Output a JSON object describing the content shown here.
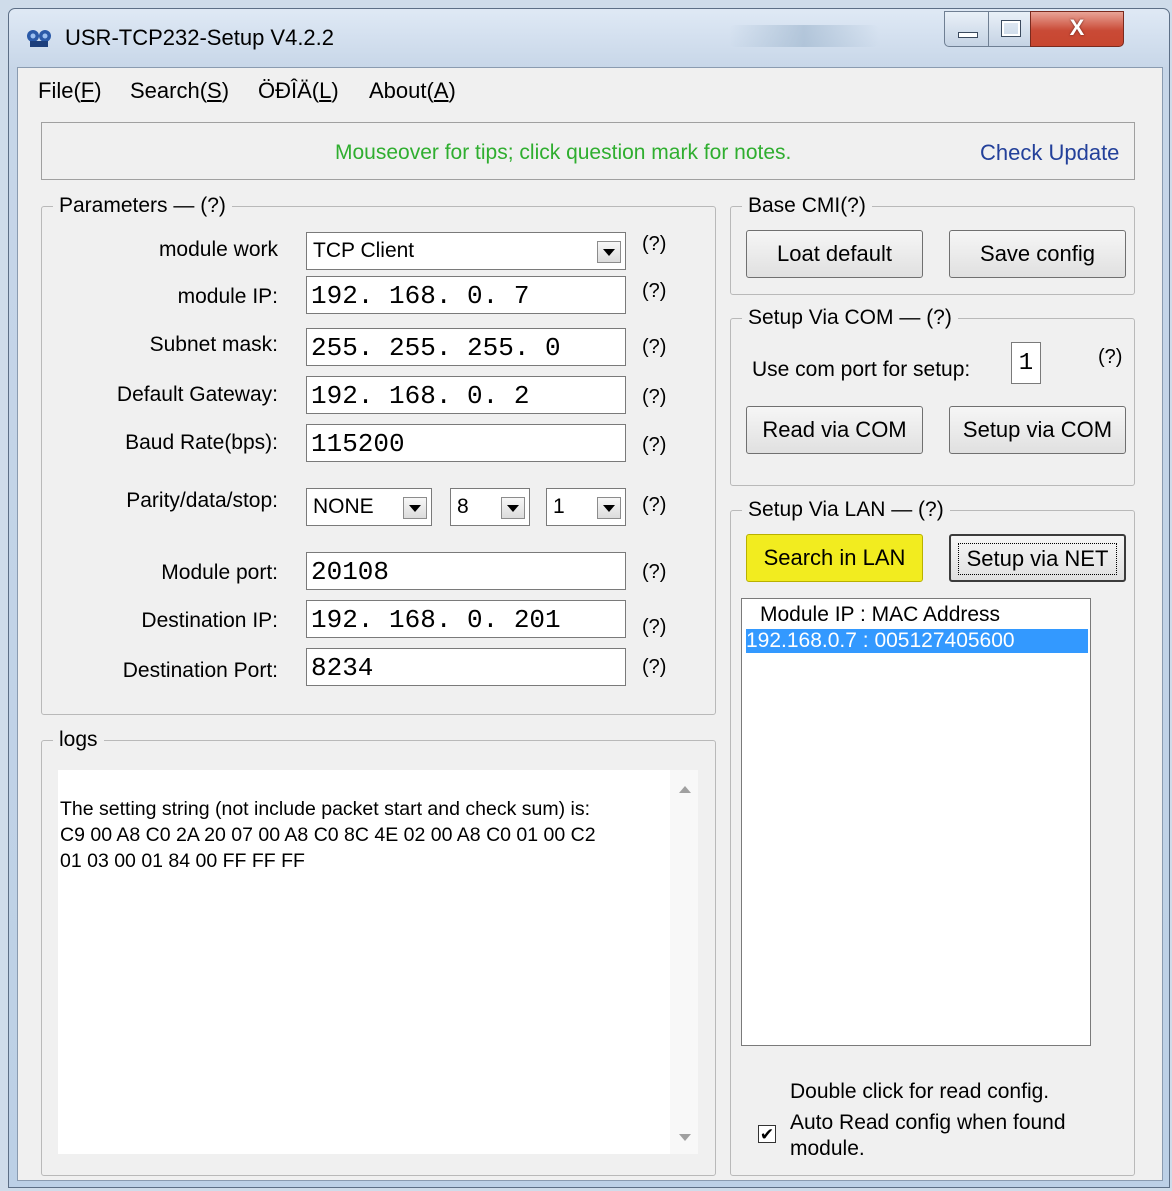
{
  "window": {
    "title": "USR-TCP232-Setup V4.2.2",
    "close_glyph": "X"
  },
  "menu": [
    {
      "label": "File(",
      "key": "F",
      "end": ")"
    },
    {
      "label": "Search(",
      "key": "S",
      "end": ")"
    },
    {
      "label": "ÖÐÎÄ(",
      "key": "L",
      "end": ")"
    },
    {
      "label": "About(",
      "key": "A",
      "end": ")"
    }
  ],
  "tipbar": {
    "tip": "Mouseover for tips; click question mark for notes.",
    "update": "Check Update",
    "tip_color": "#2fae2f"
  },
  "parameters": {
    "legend": "Parameters",
    "help": "(?)",
    "module_work": {
      "label": "module work",
      "value": "TCP Client"
    },
    "module_ip": {
      "label": "module IP:",
      "value": "192. 168. 0. 7"
    },
    "subnet": {
      "label": "Subnet mask:",
      "value": "255. 255. 255. 0"
    },
    "gateway": {
      "label": "Default Gateway:",
      "value": "192. 168. 0. 2"
    },
    "baud": {
      "label": "Baud Rate(bps):",
      "value": "115200"
    },
    "pds": {
      "label": "Parity/data/stop:",
      "parity": "NONE",
      "data": "8",
      "stop": "1"
    },
    "module_port": {
      "label": "Module port:",
      "value": "20108"
    },
    "dest_ip": {
      "label": "Destination IP:",
      "value": "192. 168. 0. 201"
    },
    "dest_port": {
      "label": "Destination Port:",
      "value": "8234"
    }
  },
  "base_cmd": {
    "legend": "Base CMI(?)",
    "load_default": "Loat default",
    "save_config": "Save config"
  },
  "setup_com": {
    "legend": "Setup Via COM",
    "help": "(?)",
    "port_label": "Use com port for setup:",
    "port_value": "1",
    "read_btn": "Read via COM",
    "setup_btn": "Setup via COM"
  },
  "setup_lan": {
    "legend": "Setup Via LAN",
    "help": "(?)",
    "search_btn": "Search in LAN",
    "setup_btn": "Setup via NET",
    "list_header": "Module IP  :  MAC Address",
    "list_rows": [
      "192.168.0.7 : 005127405600"
    ],
    "dbl_click": "Double click for read config.",
    "auto_read": "Auto Read config when found module.",
    "auto_checked": "✔",
    "search_color": "#f2ec1f"
  },
  "logs": {
    "legend": "logs",
    "text": "The setting string (not include packet start and check sum) is:\nC9 00 A8 C0 2A 20 07 00 A8 C0 8C 4E 02 00 A8 C0 01 00 C2\n01 03 00 01 84 00 FF FF FF"
  }
}
